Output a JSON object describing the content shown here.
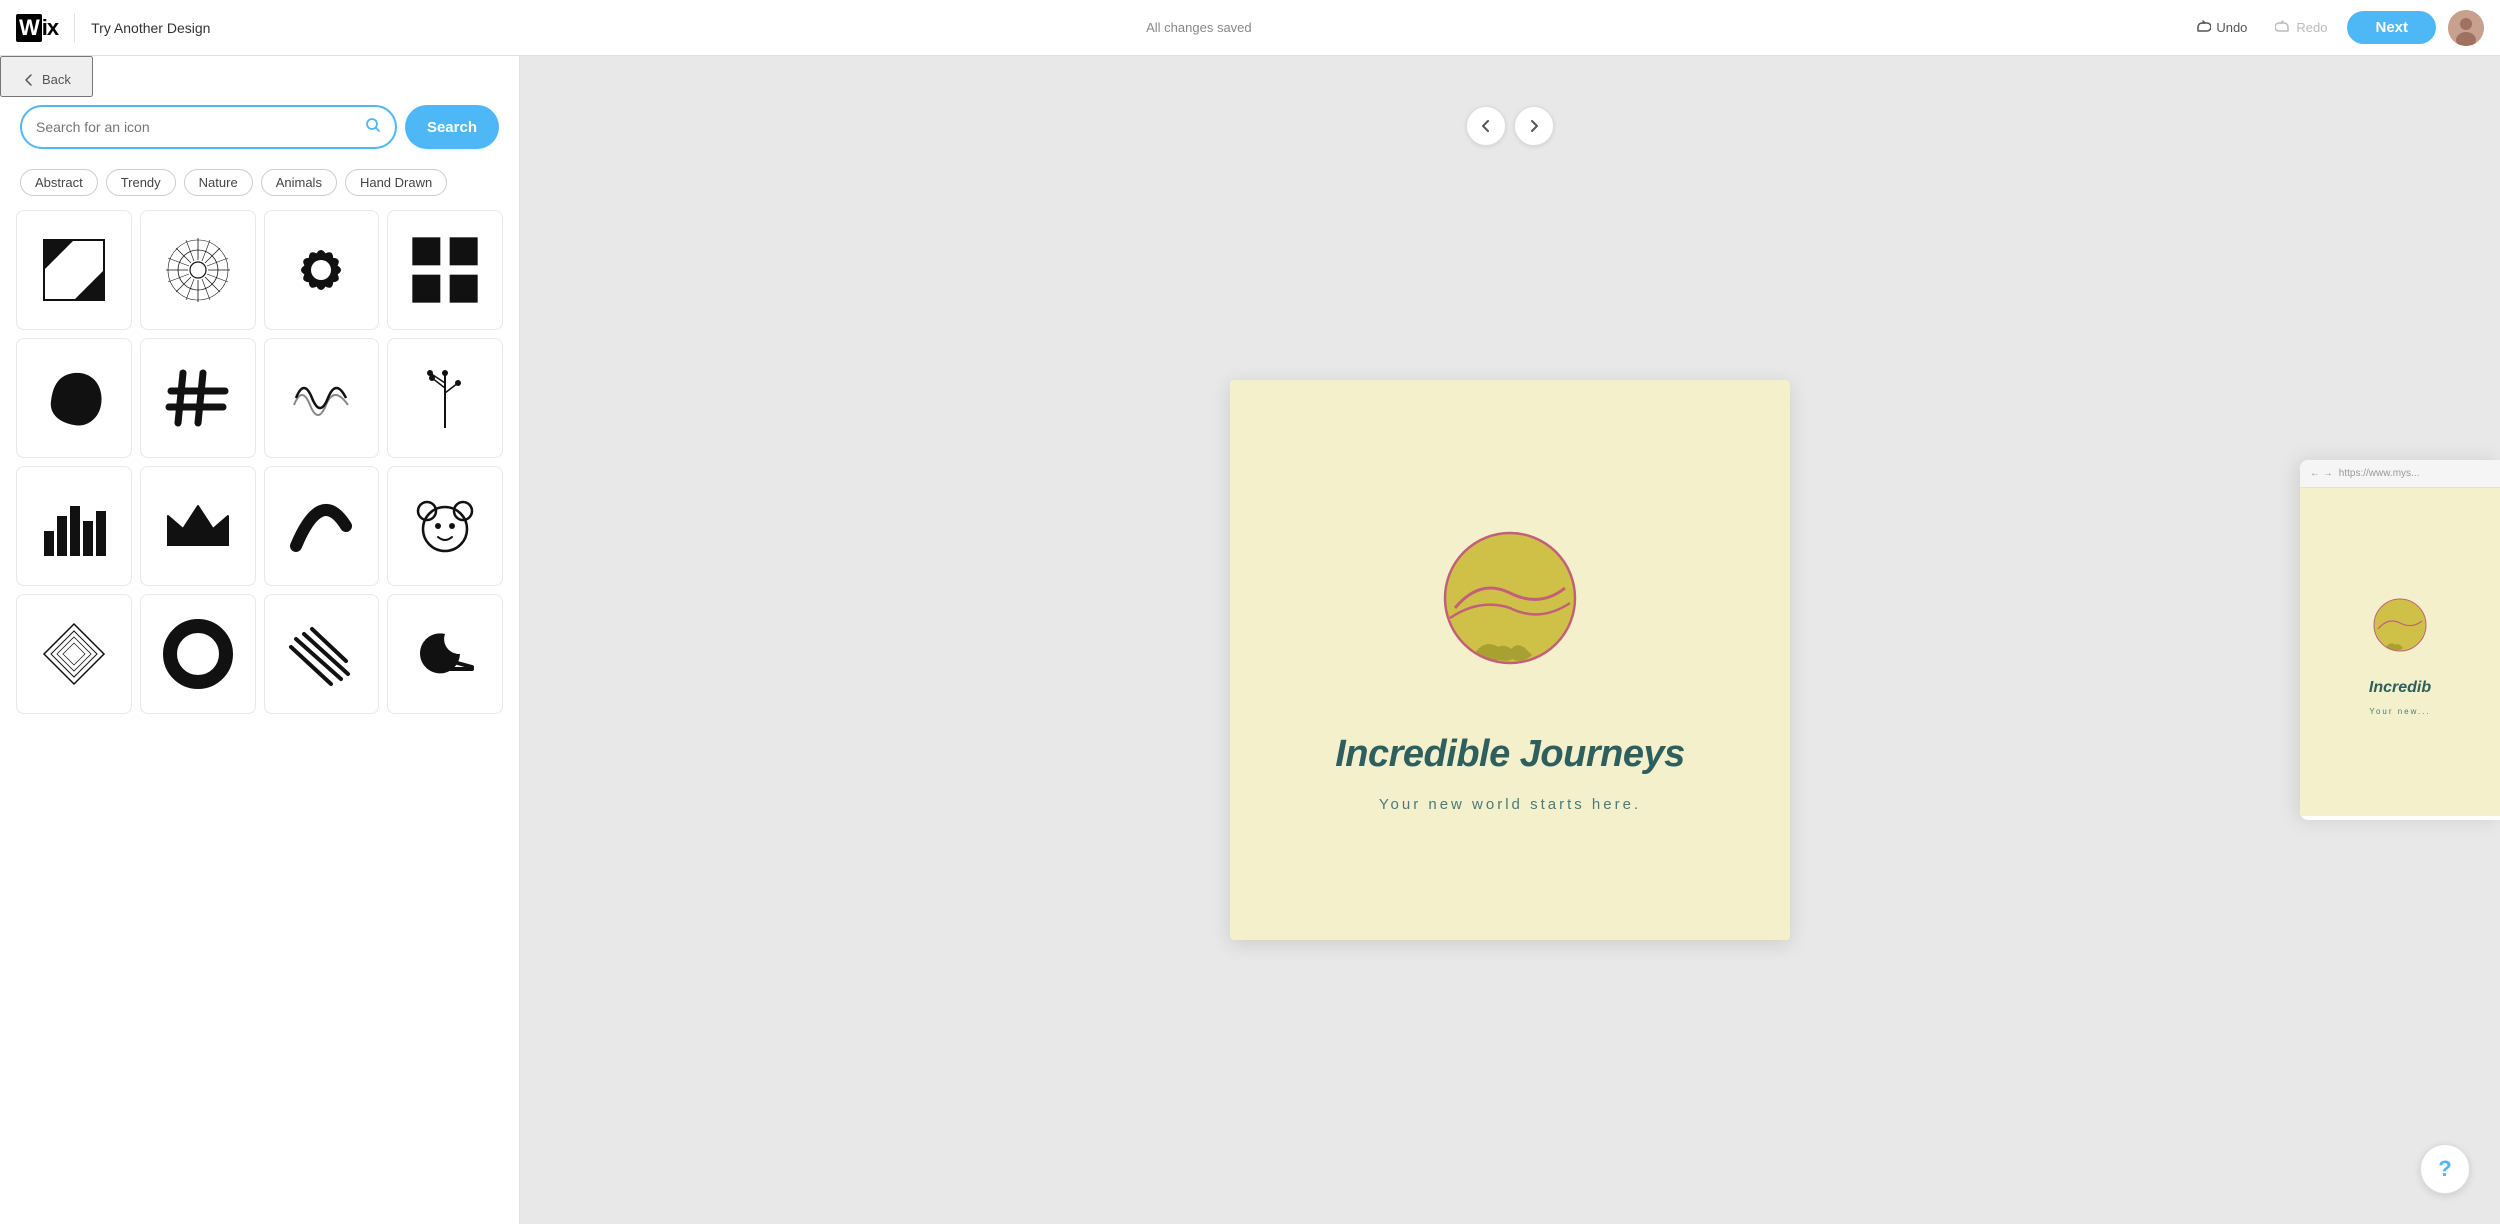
{
  "topnav": {
    "wix_logo": "WiX",
    "try_another_label": "Try Another Design",
    "all_changes_label": "All changes saved",
    "undo_label": "Undo",
    "redo_label": "Redo",
    "next_label": "Next"
  },
  "left_panel": {
    "back_label": "Back",
    "search_placeholder": "Search for an icon",
    "search_button_label": "Search",
    "tags": [
      "Abstract",
      "Trendy",
      "Nature",
      "Animals",
      "Hand Drawn"
    ],
    "icons": [
      {
        "id": "icon-1",
        "shape": "square-diagonal"
      },
      {
        "id": "icon-2",
        "shape": "sunburst"
      },
      {
        "id": "icon-3",
        "shape": "flower"
      },
      {
        "id": "icon-4",
        "shape": "grid4"
      },
      {
        "id": "icon-5",
        "shape": "blob"
      },
      {
        "id": "icon-6",
        "shape": "hashtag"
      },
      {
        "id": "icon-7",
        "shape": "wave-line"
      },
      {
        "id": "icon-8",
        "shape": "plant"
      },
      {
        "id": "icon-9",
        "shape": "bars"
      },
      {
        "id": "icon-10",
        "shape": "crown"
      },
      {
        "id": "icon-11",
        "shape": "swoosh"
      },
      {
        "id": "icon-12",
        "shape": "bear"
      },
      {
        "id": "icon-13",
        "shape": "geo-circle"
      },
      {
        "id": "icon-14",
        "shape": "ring"
      },
      {
        "id": "icon-15",
        "shape": "stripes"
      },
      {
        "id": "icon-16",
        "shape": "crescent"
      }
    ]
  },
  "canvas": {
    "logo_title": "Incredible Journeys",
    "logo_subtitle": "Your new world starts here.",
    "prev_label": "←",
    "next_label": "→"
  },
  "preview_peek": {
    "url": "https://www.mys...",
    "title": "Incredib",
    "subtitle": "Your new..."
  },
  "help_label": "?"
}
